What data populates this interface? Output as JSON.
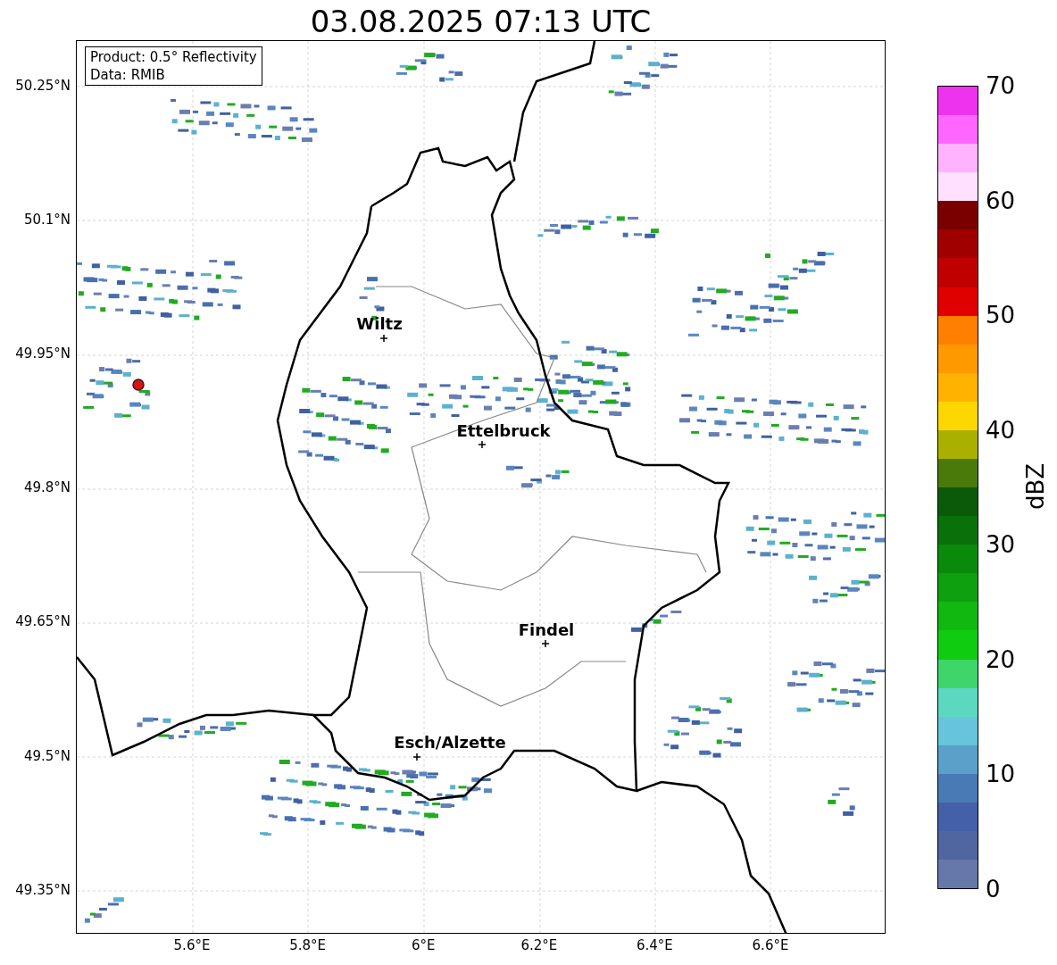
{
  "title": "03.08.2025 07:13 UTC",
  "map": {
    "info_box": [
      "Product: 0.5° Reflectivity",
      "Data: RMIB"
    ],
    "lat_ticks": [
      "50.25°N",
      "50.1°N",
      "49.95°N",
      "49.8°N",
      "49.65°N",
      "49.5°N",
      "49.35°N"
    ],
    "lon_ticks": [
      "5.6°E",
      "5.8°E",
      "6°E",
      "6.2°E",
      "6.4°E",
      "6.6°E"
    ],
    "cities": [
      {
        "name": "Wiltz"
      },
      {
        "name": "Ettelbruck"
      },
      {
        "name": "Findel"
      },
      {
        "name": "Esch/Alzette"
      }
    ]
  },
  "colorbar": {
    "label": "dBZ",
    "ticks": [
      "70",
      "60",
      "50",
      "40",
      "30",
      "20",
      "10",
      "0"
    ],
    "segments": [
      {
        "color": "#ee33ee"
      },
      {
        "color": "#ff66ff"
      },
      {
        "color": "#ffb3ff"
      },
      {
        "color": "#ffe0ff"
      },
      {
        "color": "#7a0000"
      },
      {
        "color": "#a00000"
      },
      {
        "color": "#c00000"
      },
      {
        "color": "#e00000"
      },
      {
        "color": "#ff7f00"
      },
      {
        "color": "#ff9900"
      },
      {
        "color": "#ffb300"
      },
      {
        "color": "#ffd700"
      },
      {
        "color": "#aab000"
      },
      {
        "color": "#4a7a0a"
      },
      {
        "color": "#0a5a0a"
      },
      {
        "color": "#0a700a"
      },
      {
        "color": "#0a8a0a"
      },
      {
        "color": "#0ea00e"
      },
      {
        "color": "#10b810"
      },
      {
        "color": "#10cc10"
      },
      {
        "color": "#3ed66a"
      },
      {
        "color": "#5cd8c0"
      },
      {
        "color": "#66c4dc"
      },
      {
        "color": "#5aa0c8"
      },
      {
        "color": "#4a7ab5"
      },
      {
        "color": "#4460a8"
      },
      {
        "color": "#5066a0"
      },
      {
        "color": "#6677aa"
      }
    ]
  }
}
